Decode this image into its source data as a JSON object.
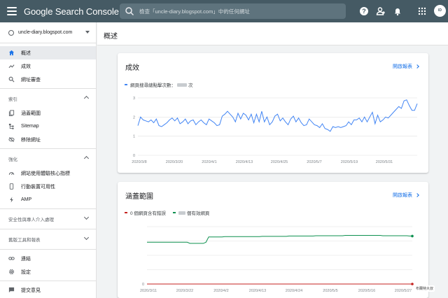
{
  "header": {
    "brand": "Google Search Console",
    "search_placeholder": "檢查「uncle-diary.blogspot.com」中的任何網址",
    "avatar_text": "ID"
  },
  "sidebar": {
    "property": "uncle-diary.blogspot.com",
    "items_top": [
      {
        "label": "概述",
        "icon": "home-icon",
        "active": true
      },
      {
        "label": "成效",
        "icon": "trending-icon"
      },
      {
        "label": "網址審查",
        "icon": "search-icon"
      }
    ],
    "section_index": "索引",
    "items_index": [
      {
        "label": "涵蓋範圍",
        "icon": "file-copy-icon"
      },
      {
        "label": "Sitemap",
        "icon": "sitemap-icon"
      },
      {
        "label": "移除網址",
        "icon": "eye-off-icon"
      }
    ],
    "section_enhance": "強化",
    "items_enhance": [
      {
        "label": "網站使用體驗核心指標",
        "icon": "speed-icon"
      },
      {
        "label": "行動裝置可用性",
        "icon": "phone-icon"
      },
      {
        "label": "AMP",
        "icon": "bolt-icon"
      }
    ],
    "section_security": "安全性與專人介入處理",
    "section_legacy": "舊版工具和報表",
    "items_bottom": [
      {
        "label": "連結",
        "icon": "link-icon"
      },
      {
        "label": "設定",
        "icon": "gear-icon"
      }
    ],
    "feedback": "提交意見"
  },
  "page": {
    "title": "概述"
  },
  "performance": {
    "title": "成效",
    "open_report": "開啟報表",
    "legend": "網頁搜尋總點擊次數：",
    "legend_suffix": "次"
  },
  "coverage": {
    "title": "涵蓋範圍",
    "open_report": "開啟報表",
    "legend_error": "0 個網頁含有錯誤",
    "legend_valid": "個有效網頁"
  },
  "watermark": "布蘭特大叔",
  "colors": {
    "topbar": "#455a64",
    "clicks": "#4285f4",
    "valid": "#0d904f",
    "error": "#c5221f",
    "link": "#1a73e8"
  },
  "chart_data": [
    {
      "type": "line",
      "title": "成效",
      "x_labels": [
        "2020/3/8",
        "2020/3/20",
        "2020/4/1",
        "2020/4/13",
        "2020/4/25",
        "2020/5/7",
        "2020/5/19",
        "2020/5/31"
      ],
      "y_ticks": [
        "0",
        "1",
        "2",
        "3"
      ],
      "ylim": [
        0,
        3
      ],
      "series": [
        {
          "name": "網頁搜尋總點擊次數",
          "color": "#4285f4",
          "values": [
            1.55,
            2.0,
            1.85,
            1.8,
            1.75,
            1.85,
            1.7,
            1.9,
            1.55,
            1.5,
            1.6,
            1.7,
            1.85,
            1.95,
            1.8,
            1.95,
            1.65,
            1.75,
            1.9,
            1.65,
            1.8,
            1.85,
            1.6,
            1.75,
            1.85,
            1.7,
            1.6,
            1.9,
            1.8,
            1.7,
            1.55,
            1.6,
            2.05,
            2.15,
            2.3,
            2.15,
            2.0,
            1.75,
            2.2,
            1.9,
            2.2,
            2.1,
            1.85,
            2.15,
            1.7,
            2.15,
            1.75,
            2.3,
            1.75,
            2.0,
            1.6,
            1.75,
            2.05,
            2.15,
            1.8,
            1.95,
            1.75,
            1.6,
            1.9,
            2.05,
            1.75,
            1.95,
            1.7,
            1.55,
            1.6,
            1.9,
            1.75,
            1.6,
            1.55,
            1.45,
            1.65,
            1.4,
            1.35,
            1.25,
            1.5,
            1.45,
            1.5,
            1.45,
            1.5,
            1.55,
            1.75,
            1.6,
            1.85,
            1.85,
            1.95,
            1.75,
            2.0,
            1.75,
            2.0,
            2.25,
            1.65,
            2.1,
            1.75,
            1.85,
            2.0,
            1.95,
            2.1,
            2.25,
            2.4,
            2.55,
            2.45,
            2.85,
            2.9,
            2.6,
            2.35,
            2.35,
            2.7
          ]
        }
      ]
    },
    {
      "type": "line",
      "title": "涵蓋範圍",
      "x_labels": [
        "2020/3/11",
        "2020/3/22",
        "2020/4/2",
        "2020/4/13",
        "2020/4/24",
        "2020/5/5",
        "2020/5/16",
        "2020/5/27"
      ],
      "y_ticks": [
        "0",
        "",
        "",
        "",
        ""
      ],
      "ylim": [
        0,
        360
      ],
      "series": [
        {
          "name": "個有效網頁",
          "color": "#0d904f",
          "values": [
            262,
            262,
            262,
            262,
            262,
            262,
            262,
            262,
            262,
            262,
            262,
            262,
            262,
            262,
            262,
            262,
            255,
            255,
            255,
            255,
            255,
            255,
            262,
            295,
            295,
            295,
            295,
            295,
            295,
            297,
            297,
            297,
            297,
            297,
            297,
            297,
            297,
            297,
            297,
            297,
            297,
            297,
            297,
            299,
            299,
            299,
            299,
            299,
            299,
            299,
            299,
            299,
            299,
            301,
            301,
            301,
            301,
            301,
            301,
            301,
            301,
            301,
            301,
            303,
            303,
            303,
            303,
            303,
            303,
            303,
            303,
            303,
            303,
            303,
            305,
            305,
            305,
            305,
            305,
            305,
            305,
            305,
            305,
            305,
            305,
            305,
            305,
            305,
            303,
            303,
            303,
            303,
            303,
            303,
            303,
            303,
            303,
            303,
            301,
            301
          ]
        },
        {
          "name": "0 個網頁含有錯誤",
          "color": "#c5221f",
          "values": [
            0,
            0,
            0,
            0,
            0,
            0,
            0,
            0,
            0,
            0,
            0,
            0,
            0,
            0,
            0,
            0,
            0,
            0,
            0,
            0,
            0,
            0,
            0,
            0,
            0,
            0,
            0,
            0,
            0,
            0,
            0,
            0,
            0,
            0,
            0,
            0,
            0,
            0,
            0,
            0,
            0,
            0,
            0,
            0,
            0,
            0,
            0,
            0,
            0,
            0,
            0,
            0,
            0,
            0,
            0,
            0,
            0,
            0,
            0,
            0,
            0,
            0,
            0,
            0,
            0,
            0,
            0,
            0,
            0,
            0,
            0,
            0,
            0,
            0,
            0,
            0,
            0,
            0,
            0,
            0,
            0,
            0,
            0,
            0,
            0,
            0,
            0,
            0,
            0,
            0,
            0,
            0,
            0,
            0,
            0,
            0,
            0,
            0,
            0,
            0
          ]
        }
      ]
    }
  ]
}
